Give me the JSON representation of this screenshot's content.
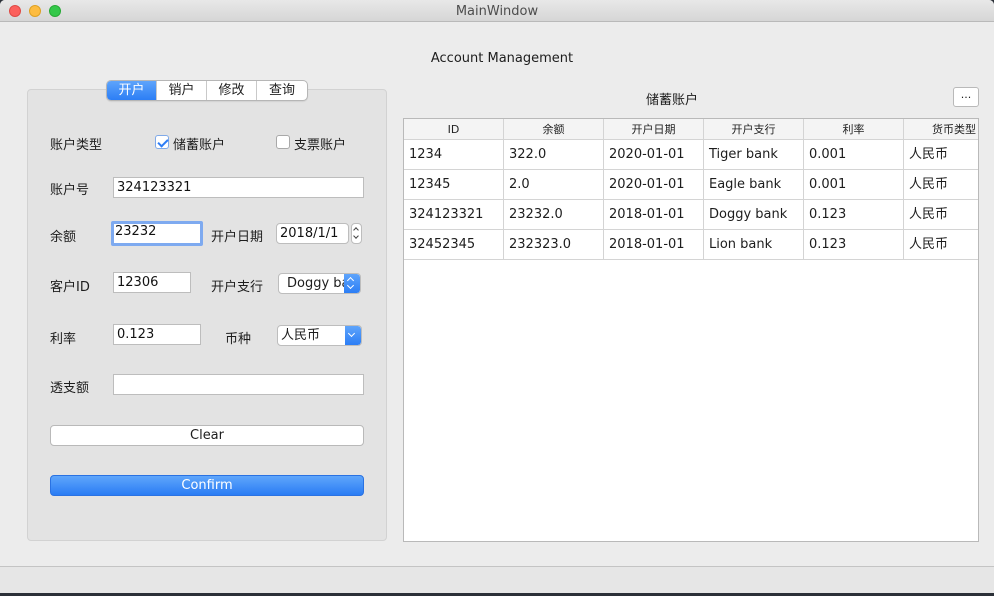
{
  "window": {
    "title": "MainWindow"
  },
  "app": {
    "title": "Account Management"
  },
  "tabs": [
    {
      "label": "开户",
      "active": true
    },
    {
      "label": "销户",
      "active": false
    },
    {
      "label": "修改",
      "active": false
    },
    {
      "label": "查询",
      "active": false
    }
  ],
  "form": {
    "account_type_label": "账户类型",
    "savings_checkbox": {
      "label": "储蓄账户",
      "checked": true
    },
    "checking_checkbox": {
      "label": "支票账户",
      "checked": false
    },
    "account_no_label": "账户号",
    "account_no_value": "324123321",
    "balance_label": "余额",
    "balance_value": "23232",
    "open_date_label": "开户日期",
    "open_date_value": "2018/1/1",
    "customer_id_label": "客户ID",
    "customer_id_value": "12306",
    "branch_label": "开户支行",
    "branch_value": "Doggy ba",
    "rate_label": "利率",
    "rate_value": "0.123",
    "currency_label": "币种",
    "currency_value": "人民币",
    "overdraft_label": "透支额",
    "overdraft_value": "",
    "clear_label": "Clear",
    "confirm_label": "Confirm"
  },
  "table": {
    "title": "储蓄账户",
    "more_label": "...",
    "headers": [
      "ID",
      "余额",
      "开户日期",
      "开户支行",
      "利率",
      "货币类型"
    ],
    "rows": [
      [
        "1234",
        "322.0",
        "2020-01-01",
        "Tiger bank",
        "0.001",
        "人民币"
      ],
      [
        "12345",
        "2.0",
        "2020-01-01",
        "Eagle bank",
        "0.001",
        "人民币"
      ],
      [
        "324123321",
        "23232.0",
        "2018-01-01",
        "Doggy bank",
        "0.123",
        "人民币"
      ],
      [
        "32452345",
        "232323.0",
        "2018-01-01",
        "Lion bank",
        "0.123",
        "人民币"
      ]
    ]
  },
  "colors": {
    "accent": "#2c7ef5",
    "focus_ring": "#7eaaf0",
    "window_bg": "#ececec"
  }
}
